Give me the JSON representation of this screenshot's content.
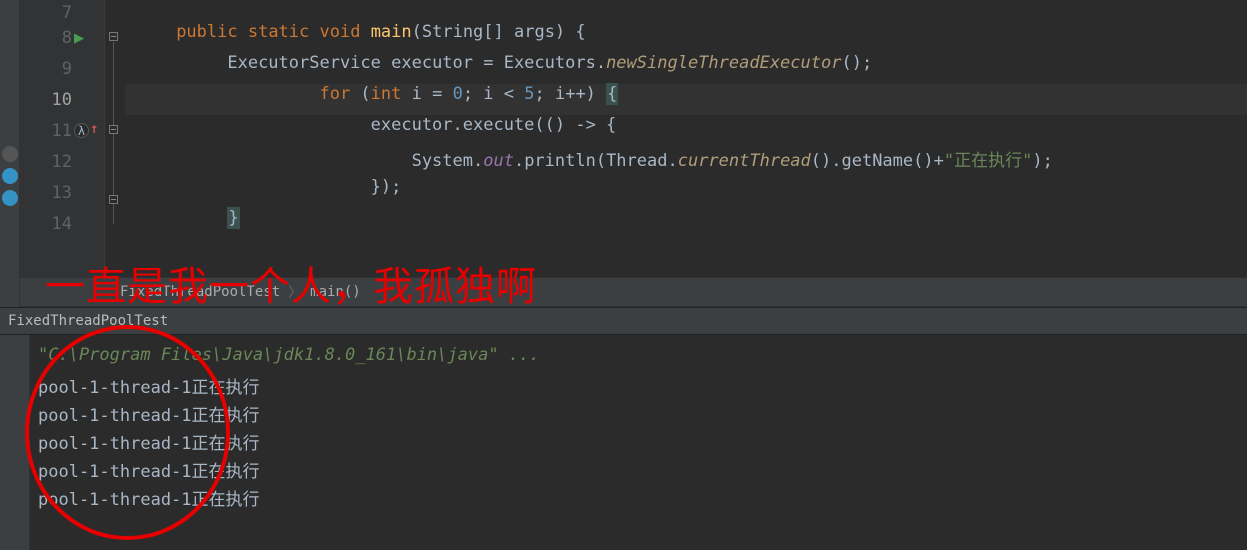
{
  "editor": {
    "lines": {
      "l7": "7",
      "l8": "8",
      "l9": "9",
      "l10": "10",
      "l11": "11",
      "l12": "12",
      "l13": "13",
      "l14": "14"
    },
    "code": {
      "l8": {
        "kw1": "public ",
        "kw2": "static ",
        "kw3": "void ",
        "method": "main",
        "args": "(String[] args) {"
      },
      "l9": {
        "type": "ExecutorService ",
        "var": "executor = Executors.",
        "call": "newSingleThreadExecutor",
        "end": "();"
      },
      "l10": {
        "kw1": "for ",
        "open": "(",
        "kw2": "int ",
        "body1": "i = ",
        "n0": "0",
        "body2": "; i < ",
        "n5": "5",
        "body3": "; i++) ",
        "brace": "{"
      },
      "l11": {
        "body": "executor.execute(() -> {"
      },
      "l12": {
        "sys": "System.",
        "out": "out",
        "print": ".println(Thread.",
        "curr": "currentThread",
        "tail": "().getName()+",
        "str": "\"正在执行\"",
        "end": ");"
      },
      "l13": {
        "body": "});"
      },
      "l14": {
        "brace": "}"
      }
    }
  },
  "breadcrumb": {
    "class": "FixedThreadPoolTest",
    "method": "main()"
  },
  "run": {
    "tab": "FixedThreadPoolTest"
  },
  "console": {
    "cmd": "\"C:\\Program Files\\Java\\jdk1.8.0_161\\bin\\java\" ...",
    "out1": "pool-1-thread-1正在执行",
    "out2": "pool-1-thread-1正在执行",
    "out3": "pool-1-thread-1正在执行",
    "out4": "pool-1-thread-1正在执行",
    "out5": "pool-1-thread-1正在执行"
  },
  "annotation": {
    "text": "一直是我一个人，我孤独啊"
  }
}
